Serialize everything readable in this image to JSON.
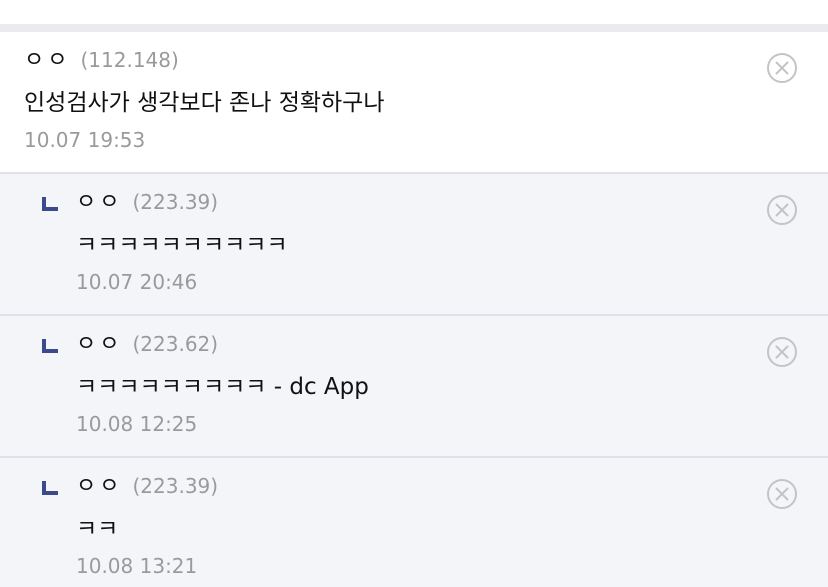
{
  "comments": [
    {
      "nickname": "ㅇㅇ",
      "ip": "(112.148)",
      "text": "인성검사가 생각보다 존나 정확하구나",
      "time": "10.07 19:53"
    }
  ],
  "replies": [
    {
      "nickname": "ㅇㅇ",
      "ip": "(223.39)",
      "text": "ㅋㅋㅋㅋㅋㅋㅋㅋㅋㅋ",
      "time": "10.07 20:46"
    },
    {
      "nickname": "ㅇㅇ",
      "ip": "(223.62)",
      "text": "ㅋㅋㅋㅋㅋㅋㅋㅋㅋ - dc App",
      "time": "10.08 12:25"
    },
    {
      "nickname": "ㅇㅇ",
      "ip": "(223.39)",
      "text": "ㅋㅋ",
      "time": "10.08 13:21"
    }
  ],
  "icons": {
    "close": "close-circle-icon",
    "reply": "reply-arrow-icon"
  },
  "colors": {
    "reply_mark": "#3b4a8c",
    "close_icon": "#c4c4c4",
    "reply_background": "#f4f5f9"
  }
}
